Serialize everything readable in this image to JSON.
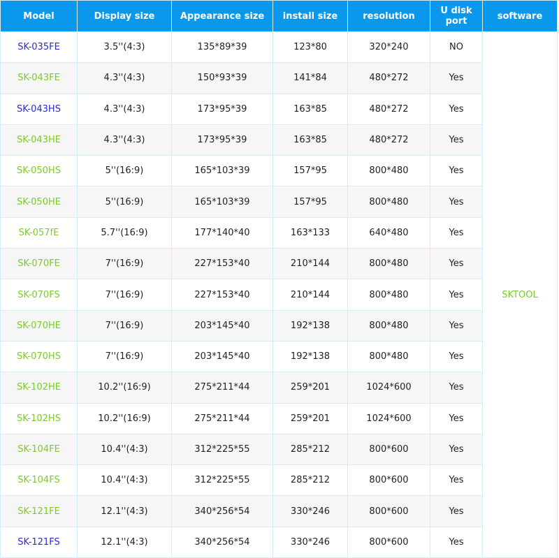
{
  "headers": [
    "Model",
    "Display size",
    "Appearance size",
    "install size",
    "resolution",
    "U disk port",
    "software"
  ],
  "software": "SKTOOL",
  "colors": {
    "header": "#0a98ec",
    "green": "#7acb2a",
    "blue": "#2a2ad0"
  },
  "rows": [
    {
      "model": "SK-035FE",
      "color": "blue",
      "display": "3.5''(4:3)",
      "appearance": "135*89*39",
      "install": "123*80",
      "resolution": "320*240",
      "udisk": "NO"
    },
    {
      "model": "SK-043FE",
      "color": "green",
      "display": "4.3''(4:3)",
      "appearance": "150*93*39",
      "install": "141*84",
      "resolution": "480*272",
      "udisk": "Yes"
    },
    {
      "model": "SK-043HS",
      "color": "blue",
      "display": "4.3''(4:3)",
      "appearance": "173*95*39",
      "install": "163*85",
      "resolution": "480*272",
      "udisk": "Yes"
    },
    {
      "model": "SK-043HE",
      "color": "green",
      "display": "4.3''(4:3)",
      "appearance": "173*95*39",
      "install": "163*85",
      "resolution": "480*272",
      "udisk": "Yes"
    },
    {
      "model": "SK-050HS",
      "color": "green",
      "display": "5''(16:9)",
      "appearance": "165*103*39",
      "install": "157*95",
      "resolution": "800*480",
      "udisk": "Yes"
    },
    {
      "model": "SK-050HE",
      "color": "green",
      "display": "5''(16:9)",
      "appearance": "165*103*39",
      "install": "157*95",
      "resolution": "800*480",
      "udisk": "Yes"
    },
    {
      "model": "SK-057fE",
      "color": "green",
      "display": "5.7''(16:9)",
      "appearance": "177*140*40",
      "install": "163*133",
      "resolution": "640*480",
      "udisk": "Yes"
    },
    {
      "model": "SK-070FE",
      "color": "green",
      "display": "7''(16:9)",
      "appearance": "227*153*40",
      "install": "210*144",
      "resolution": "800*480",
      "udisk": "Yes"
    },
    {
      "model": "SK-070FS",
      "color": "green",
      "display": "7''(16:9)",
      "appearance": "227*153*40",
      "install": "210*144",
      "resolution": "800*480",
      "udisk": "Yes"
    },
    {
      "model": "SK-070HE",
      "color": "green",
      "display": "7''(16:9)",
      "appearance": "203*145*40",
      "install": "192*138",
      "resolution": "800*480",
      "udisk": "Yes"
    },
    {
      "model": "SK-070HS",
      "color": "green",
      "display": "7''(16:9)",
      "appearance": "203*145*40",
      "install": "192*138",
      "resolution": "800*480",
      "udisk": "Yes"
    },
    {
      "model": "SK-102HE",
      "color": "green",
      "display": "10.2''(16:9)",
      "appearance": "275*211*44",
      "install": "259*201",
      "resolution": "1024*600",
      "udisk": "Yes"
    },
    {
      "model": "SK-102HS",
      "color": "green",
      "display": "10.2''(16:9)",
      "appearance": "275*211*44",
      "install": "259*201",
      "resolution": "1024*600",
      "udisk": "Yes"
    },
    {
      "model": "SK-104FE",
      "color": "green",
      "display": "10.4''(4:3)",
      "appearance": "312*225*55",
      "install": "285*212",
      "resolution": "800*600",
      "udisk": "Yes"
    },
    {
      "model": "SK-104FS",
      "color": "green",
      "display": "10.4''(4:3)",
      "appearance": "312*225*55",
      "install": "285*212",
      "resolution": "800*600",
      "udisk": "Yes"
    },
    {
      "model": "SK-121FE",
      "color": "green",
      "display": "12.1''(4:3)",
      "appearance": "340*256*54",
      "install": "330*246",
      "resolution": "800*600",
      "udisk": "Yes"
    },
    {
      "model": "SK-121FS",
      "color": "blue",
      "display": "12.1''(4:3)",
      "appearance": "340*256*54",
      "install": "330*246",
      "resolution": "800*600",
      "udisk": "Yes"
    }
  ]
}
